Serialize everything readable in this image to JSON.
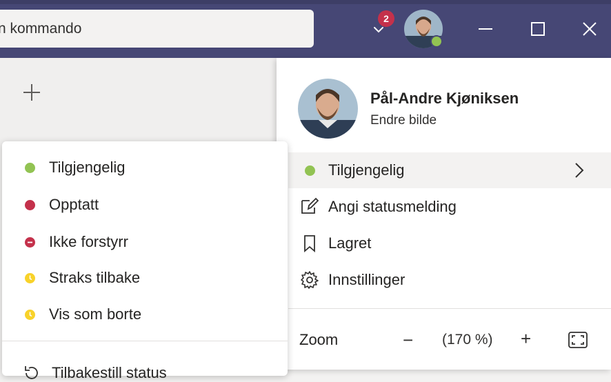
{
  "titlebar": {
    "search_text": "n kommando",
    "notification_count": "2"
  },
  "profile": {
    "name": "Pål-Andre Kjøniksen",
    "change_picture": "Endre bilde",
    "presence_color": "#92c353"
  },
  "menu": {
    "status_label": "Tilgjengelig",
    "set_status_message": "Angi statusmelding",
    "saved": "Lagret",
    "settings": "Innstillinger"
  },
  "zoom": {
    "label": "Zoom",
    "minus": "−",
    "value": "(170 %)",
    "plus": "+"
  },
  "status_menu": {
    "items": [
      {
        "label": "Tilgjengelig",
        "color": "#92c353"
      },
      {
        "label": "Opptatt",
        "color": "#c4314b"
      },
      {
        "label": "Ikke forstyrr",
        "color": "#c4314b"
      },
      {
        "label": "Straks tilbake",
        "color": "#f8d22a"
      },
      {
        "label": "Vis som borte",
        "color": "#f8d22a"
      }
    ],
    "reset_label": "Tilbakestill status"
  },
  "colors": {
    "titlebar": "#464775",
    "busy": "#c4314b",
    "available": "#92c353",
    "away": "#f8d22a"
  }
}
